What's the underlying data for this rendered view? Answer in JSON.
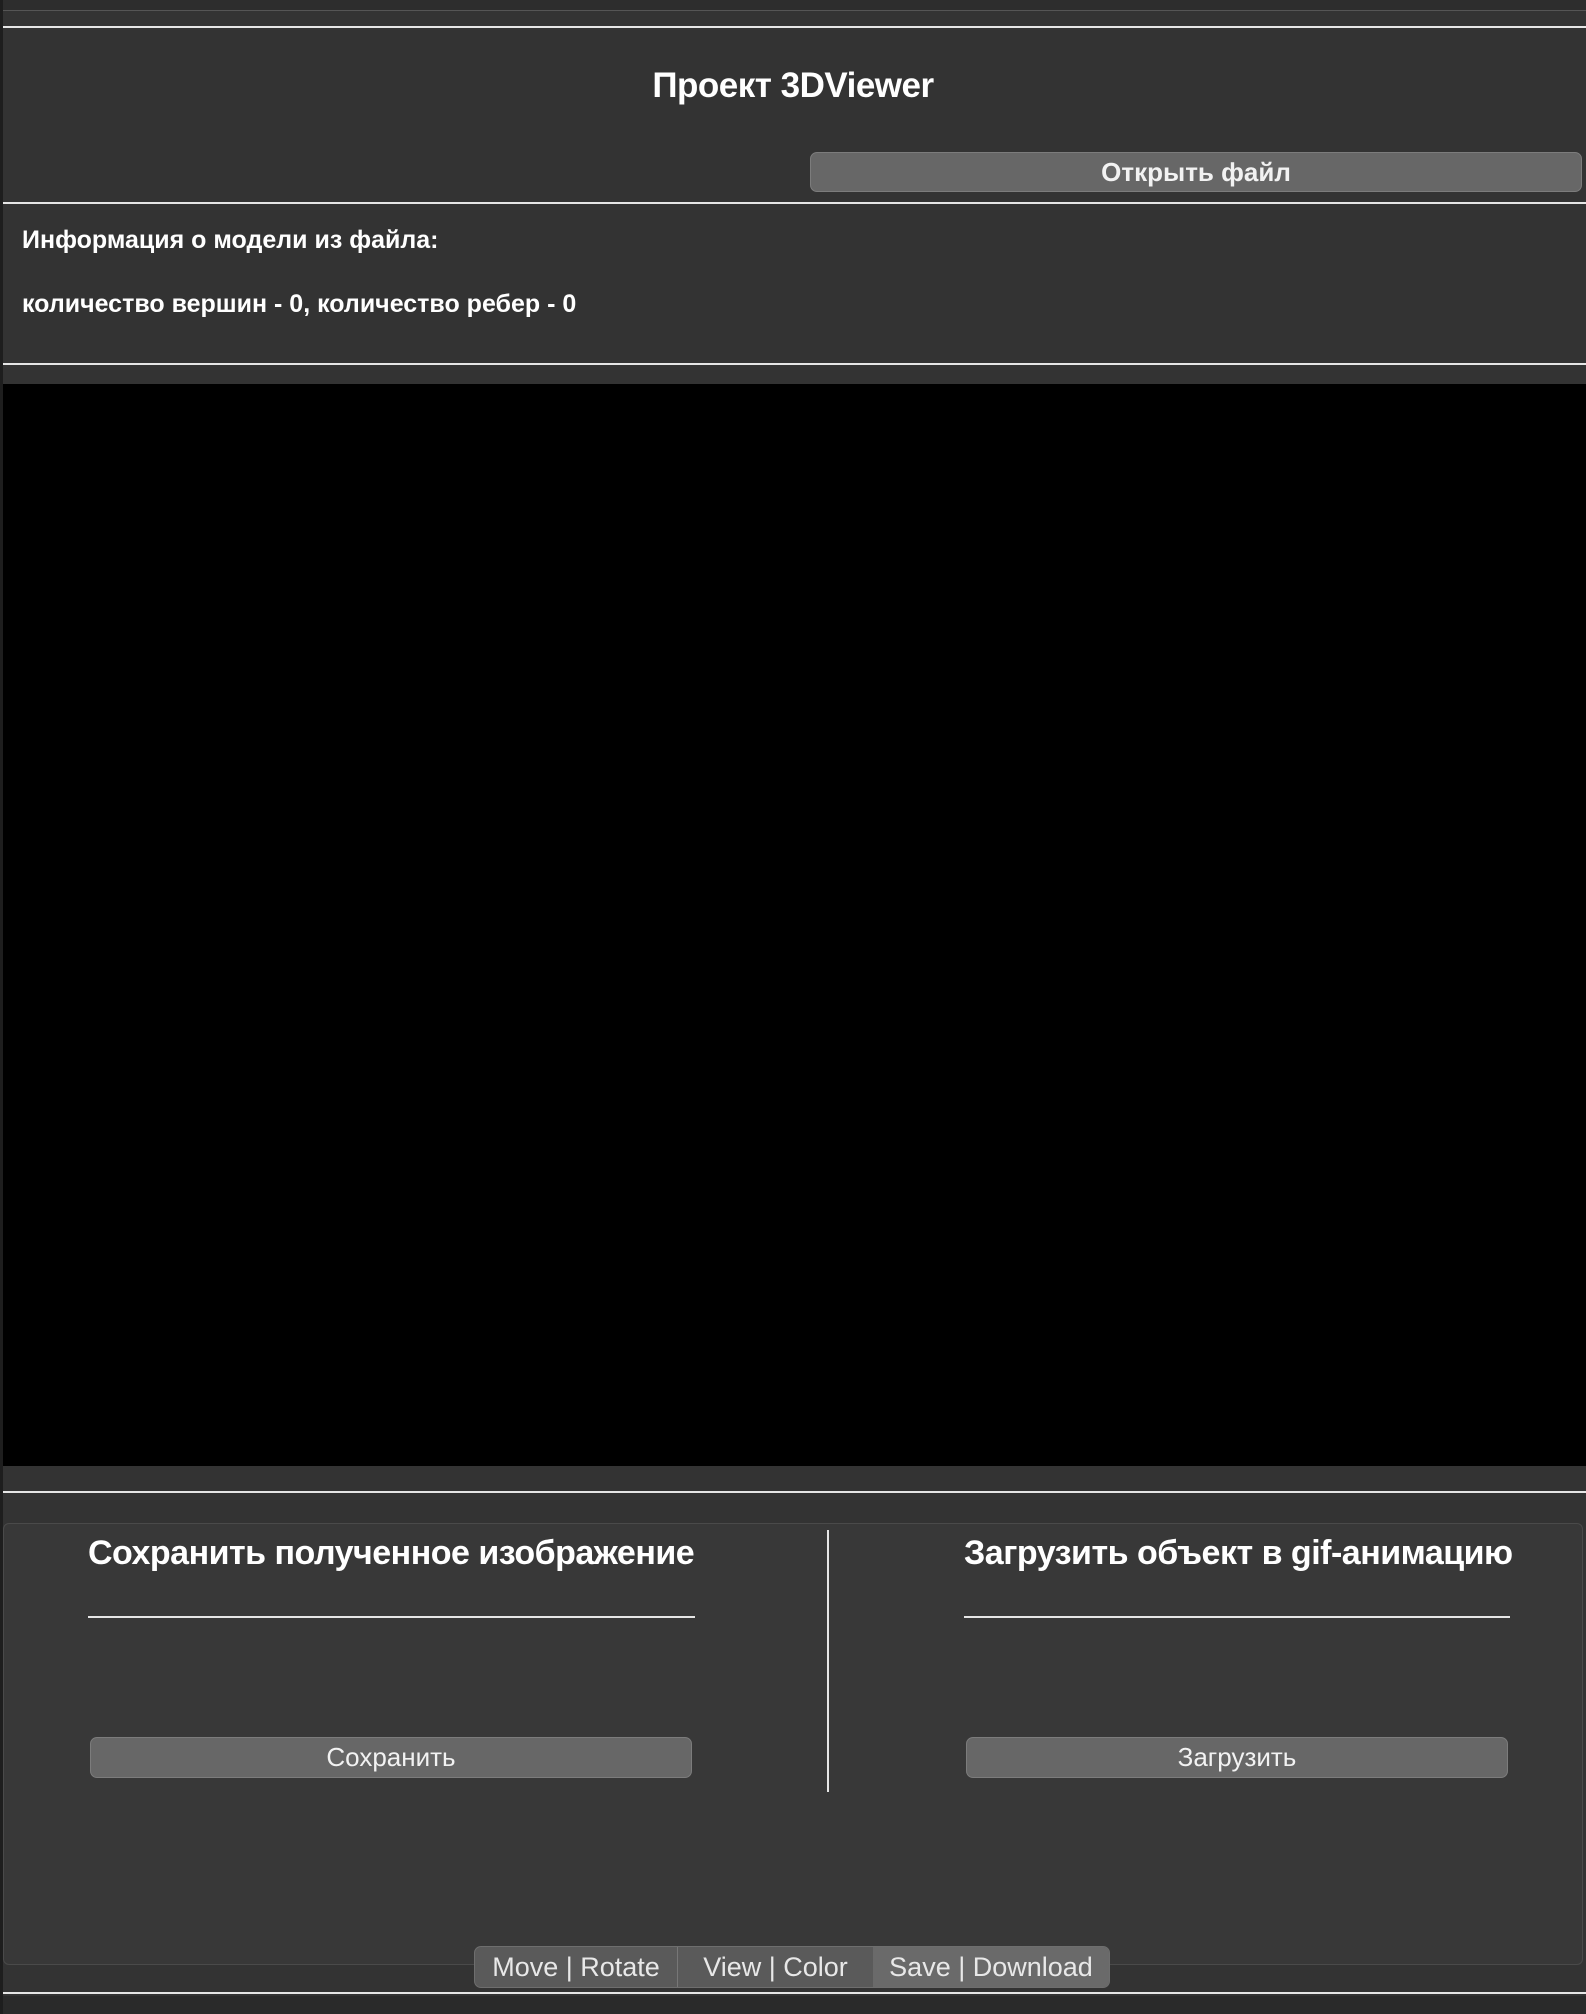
{
  "header": {
    "title": "Проект 3DViewer",
    "open_button_label": "Открыть файл"
  },
  "model_info": {
    "heading": "Информация о модели из файла:",
    "stats": "количество вершин - 0, количество ребер - 0"
  },
  "save_section": {
    "title": "Сохранить полученное изображение",
    "button_label": "Сохранить"
  },
  "gif_section": {
    "title": "Загрузить объект в gif-анимацию",
    "button_label": "Загрузить"
  },
  "tabs": [
    {
      "label": "Move | Rotate"
    },
    {
      "label": "View | Color"
    },
    {
      "label": "Save | Download",
      "active": true
    }
  ]
}
